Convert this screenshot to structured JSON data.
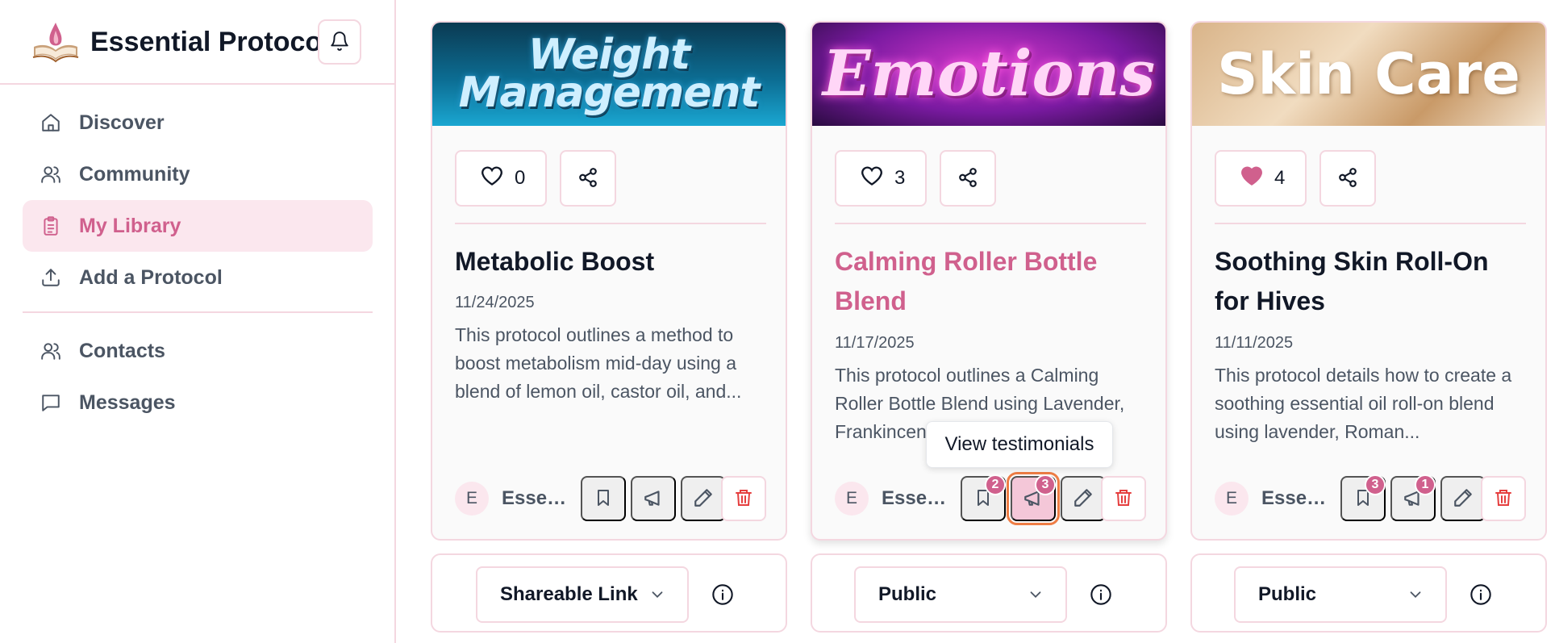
{
  "brand": {
    "name": "Essential Protocol",
    "logo_icon": "book-flame-logo",
    "bell_icon": "bell-icon"
  },
  "nav": {
    "items": [
      {
        "label": "Discover",
        "icon": "home-icon",
        "active": false
      },
      {
        "label": "Community",
        "icon": "users-icon",
        "active": false
      },
      {
        "label": "My Library",
        "icon": "clipboard-icon",
        "active": true
      },
      {
        "label": "Add a Protocol",
        "icon": "upload-icon",
        "active": false
      }
    ],
    "secondary": [
      {
        "label": "Contacts",
        "icon": "users-icon"
      },
      {
        "label": "Messages",
        "icon": "message-icon"
      }
    ]
  },
  "cards": [
    {
      "banner": "Weight Management",
      "likes": "0",
      "liked": false,
      "title": "Metabolic Boost",
      "date": "11/24/2025",
      "description": "This protocol outlines a method to boost metabolism mid-day using a blend of lemon oil, castor oil, and...",
      "avatar_initial": "E",
      "author": "Essential Protocol",
      "bookmark_count": "",
      "testimonial_count": "",
      "visibility": "Shareable Link"
    },
    {
      "banner": "Emotions",
      "likes": "3",
      "liked": false,
      "title": "Calming Roller Bottle Blend",
      "date": "11/17/2025",
      "description": "This protocol outlines a Calming Roller Bottle Blend using Lavender, Frankincense, and...",
      "avatar_initial": "E",
      "author": "Essential Protocol",
      "bookmark_count": "2",
      "testimonial_count": "3",
      "visibility": "Public"
    },
    {
      "banner": "Skin Care",
      "likes": "4",
      "liked": true,
      "title": "Soothing Skin Roll-On for Hives",
      "date": "11/11/2025",
      "description": "This protocol details how to create a soothing essential oil roll-on blend using lavender, Roman...",
      "avatar_initial": "E",
      "author": "Essential Protocol",
      "bookmark_count": "3",
      "testimonial_count": "1",
      "visibility": "Public"
    }
  ],
  "tooltip": {
    "text": "View testimonials"
  },
  "colors": {
    "accent": "#d0608d",
    "border": "#f4d7e0",
    "active_bg": "#fbe7ee",
    "trash": "#e53e3e",
    "focus_ring": "#ee7d45"
  }
}
